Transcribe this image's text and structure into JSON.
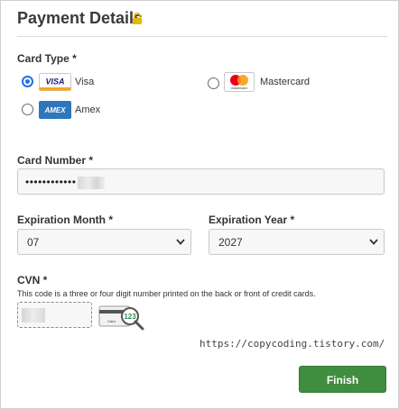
{
  "header": {
    "title": "Payment Details",
    "icon": "lock-icon",
    "lock_color": "#e6b800"
  },
  "card_type": {
    "label": "Card Type *",
    "options": [
      {
        "name": "Visa",
        "logo_text": "VISA",
        "selected": true
      },
      {
        "name": "Mastercard",
        "logo_text": "mastercard",
        "selected": false
      },
      {
        "name": "Amex",
        "logo_text": "AMEX",
        "selected": false
      }
    ]
  },
  "card_number": {
    "label": "Card Number *",
    "value": "••••••••••••"
  },
  "expiration_month": {
    "label": "Expiration Month *",
    "value": "07"
  },
  "expiration_year": {
    "label": "Expiration Year *",
    "value": "2027"
  },
  "cvn": {
    "label": "CVN *",
    "note": "This code is a three or four digit number printed on the back or front of credit cards.",
    "graphic_number": "123",
    "graphic_card_text": "Card"
  },
  "watermark": "https://copycoding.tistory.com/",
  "actions": {
    "finish_label": "Finish"
  },
  "colors": {
    "accent_blue": "#1a73e8",
    "finish_green": "#3f8d3f"
  }
}
